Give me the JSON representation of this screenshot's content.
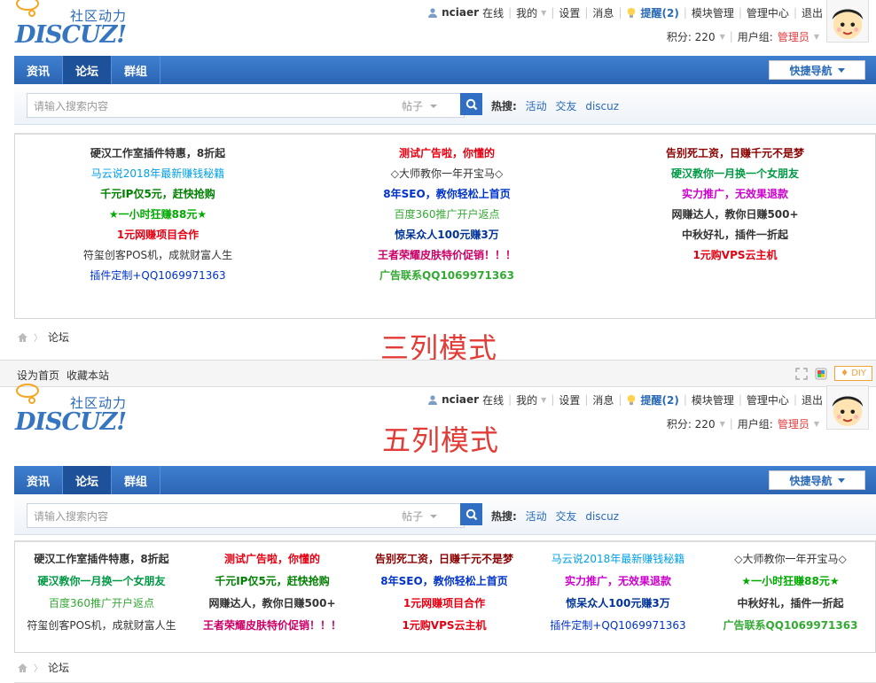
{
  "top": {
    "logo": {
      "cn": "社区动力",
      "brand": "DISCUZ!"
    },
    "user": {
      "name": "nciaer",
      "status": "在线",
      "my": "我的",
      "settings": "设置",
      "messages": "消息",
      "remind": "提醒(2)",
      "module": "模块管理",
      "admin": "管理中心",
      "logout": "退出"
    },
    "points": "积分: 220",
    "group_label": "用户组:",
    "group_value": "管理员",
    "nav": {
      "items": [
        "资讯",
        "论坛",
        "群组"
      ],
      "active": 1,
      "quick": "快捷导航"
    },
    "search": {
      "placeholder": "请输入搜索内容",
      "type": "帖子",
      "hot_label": "热搜:",
      "hot": [
        "活动",
        "交友",
        "discuz"
      ]
    },
    "ads": [
      [
        {
          "t": "硬汉工作室插件特惠，8折起",
          "c": "#333333",
          "b": true
        },
        {
          "t": "测试广告啦，你懂的",
          "c": "#e60012",
          "b": true
        },
        {
          "t": "告别死工资，日赚千元不是梦",
          "c": "#8b0000",
          "b": true
        }
      ],
      [
        {
          "t": "马云说2018年最新赚钱秘籍",
          "c": "#00a0e9",
          "b": false
        },
        {
          "t": "◇大师教你一年开宝马◇",
          "c": "#333333",
          "b": false
        },
        {
          "t": "硬汉教你一月换一个女朋友",
          "c": "#009944",
          "b": true
        }
      ],
      [
        {
          "t": "千元IP仅5元，赶快抢购",
          "c": "#008000",
          "b": true
        },
        {
          "t": "8年SEO，教你轻松上首页",
          "c": "#0033cc",
          "b": true
        },
        {
          "t": "实力推广，无效果退款",
          "c": "#cc00cc",
          "b": true
        }
      ],
      [
        {
          "t": "★一小时狂赚88元★",
          "c": "#00aa00",
          "b": true
        },
        {
          "t": "百度360推广开户返点",
          "c": "#33aa33",
          "b": false
        },
        {
          "t": "网赚达人，教你日赚500+",
          "c": "#333333",
          "b": true
        }
      ],
      [
        {
          "t": "1元网赚项目合作",
          "c": "#e60012",
          "b": true
        },
        {
          "t": "惊呆众人100元赚3万",
          "c": "#003399",
          "b": true
        },
        {
          "t": "中秋好礼，插件一折起",
          "c": "#333333",
          "b": true
        }
      ],
      [
        {
          "t": "符玺创客POS机，成就财富人生",
          "c": "#333333",
          "b": false
        },
        {
          "t": "王者荣耀皮肤特价促销！！！",
          "c": "#cc0066",
          "b": true
        },
        {
          "t": "1元购VPS云主机",
          "c": "#e60012",
          "b": true
        }
      ],
      [
        {
          "t": "插件定制+QQ1069971363",
          "c": "#0033cc",
          "b": false
        },
        {
          "t": "广告联系QQ1069971363",
          "c": "#33aa33",
          "b": true
        },
        {
          "t": "",
          "c": "#333333",
          "b": false
        }
      ]
    ],
    "crumb": "论坛",
    "overlay": "三列模式"
  },
  "footer": {
    "home": "设为首页",
    "fav": "收藏本站",
    "diy": "DIY"
  },
  "bottom": {
    "overlay": "五列模式",
    "ads": [
      [
        {
          "t": "硬汉工作室插件特惠，8折起",
          "c": "#333333",
          "b": true
        },
        {
          "t": "测试广告啦，你懂的",
          "c": "#e60012",
          "b": true
        },
        {
          "t": "告别死工资，日赚千元不是梦",
          "c": "#8b0000",
          "b": true
        },
        {
          "t": "马云说2018年最新赚钱秘籍",
          "c": "#00a0e9",
          "b": false
        },
        {
          "t": "◇大师教你一年开宝马◇",
          "c": "#333333",
          "b": false
        }
      ],
      [
        {
          "t": "硬汉教你一月换一个女朋友",
          "c": "#009944",
          "b": true
        },
        {
          "t": "千元IP仅5元，赶快抢购",
          "c": "#008000",
          "b": true
        },
        {
          "t": "8年SEO，教你轻松上首页",
          "c": "#0033cc",
          "b": true
        },
        {
          "t": "实力推广，无效果退款",
          "c": "#cc00cc",
          "b": true
        },
        {
          "t": "★一小时狂赚88元★",
          "c": "#00aa00",
          "b": true
        }
      ],
      [
        {
          "t": "百度360推广开户返点",
          "c": "#33aa33",
          "b": false
        },
        {
          "t": "网赚达人，教你日赚500+",
          "c": "#333333",
          "b": true
        },
        {
          "t": "1元网赚项目合作",
          "c": "#e60012",
          "b": true
        },
        {
          "t": "惊呆众人100元赚3万",
          "c": "#003399",
          "b": true
        },
        {
          "t": "中秋好礼，插件一折起",
          "c": "#333333",
          "b": true
        }
      ],
      [
        {
          "t": "符玺创客POS机，成就财富人生",
          "c": "#333333",
          "b": false
        },
        {
          "t": "王者荣耀皮肤特价促销！！！",
          "c": "#cc0066",
          "b": true
        },
        {
          "t": "1元购VPS云主机",
          "c": "#e60012",
          "b": true
        },
        {
          "t": "插件定制+QQ1069971363",
          "c": "#0033cc",
          "b": false
        },
        {
          "t": "广告联系QQ1069971363",
          "c": "#33aa33",
          "b": true
        }
      ]
    ]
  }
}
